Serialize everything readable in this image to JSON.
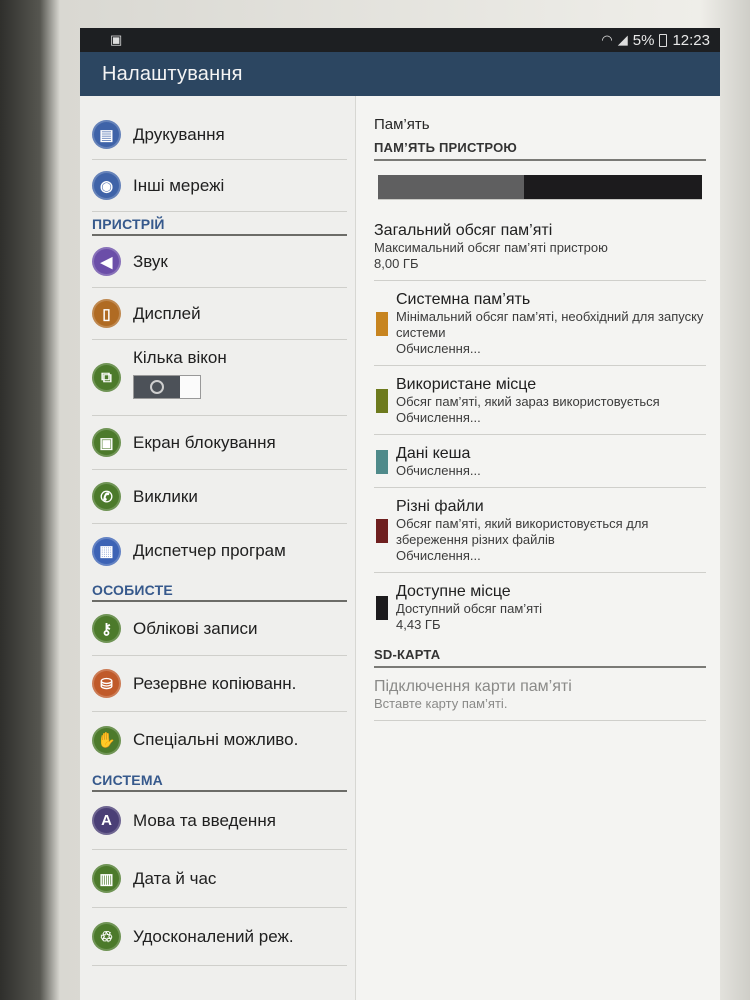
{
  "status": {
    "battery": "5%",
    "time": "12:23"
  },
  "app": {
    "title": "Налаштування"
  },
  "sidebar": {
    "items_top": [
      {
        "label": "Друкування",
        "icon": "printer-icon",
        "color": "#3f63a8"
      },
      {
        "label": "Інші мережі",
        "icon": "wireless-icon",
        "color": "#3f63a8"
      }
    ],
    "device_header": "ПРИСТРІЙ",
    "device_items": [
      {
        "label": "Звук",
        "icon": "speaker-icon",
        "color": "#6b4ea8"
      },
      {
        "label": "Дисплей",
        "icon": "display-icon",
        "color": "#b06b23"
      },
      {
        "label": "Кілька вікон",
        "icon": "multi-window-icon",
        "color": "#4c7a2b"
      },
      {
        "label": "Екран блокування",
        "icon": "lock-screen-icon",
        "color": "#4c7a2b"
      },
      {
        "label": "Виклики",
        "icon": "phone-icon",
        "color": "#4c7a2b"
      },
      {
        "label": "Диспетчер програм",
        "icon": "apps-grid-icon",
        "color": "#3d63b5"
      }
    ],
    "personal_header": "ОСОБИСТЕ",
    "personal_items": [
      {
        "label": "Облікові записи",
        "icon": "key-icon",
        "color": "#4c7a2b"
      },
      {
        "label": "Резервне копіюванн.",
        "icon": "backup-icon",
        "color": "#c05a2a"
      },
      {
        "label": "Спеціальні можливо.",
        "icon": "hand-icon",
        "color": "#4c7a2b"
      }
    ],
    "system_header": "СИСТЕМА",
    "system_items": [
      {
        "label": "Мова та введення",
        "icon": "language-icon",
        "color": "#4a3f76"
      },
      {
        "label": "Дата й час",
        "icon": "calendar-icon",
        "color": "#4c7a2b"
      },
      {
        "label": "Удосконалений реж.",
        "icon": "advanced-mode-icon",
        "color": "#4c7a2b"
      }
    ]
  },
  "storage": {
    "title": "Пам’ять",
    "device_header": "ПАМ’ЯТЬ ПРИСТРОЮ",
    "usage_bar": {
      "used_fraction": 0.45,
      "used_color": "#5f5f60",
      "free_color": "#1c1b1d"
    },
    "total": {
      "name": "Загальний обсяг пам’яті",
      "desc": "Максимальний обсяг пам’яті пристрою",
      "value": "8,00 ГБ"
    },
    "categories": [
      {
        "name": "Системна пам’ять",
        "desc": "Мінімальний обсяг пам’яті, необхідний для запуску системи",
        "value": "Обчислення...",
        "color": "#c7841f"
      },
      {
        "name": "Використане місце",
        "desc": "Обсяг пам’яті, який зараз використовується",
        "value": "Обчислення...",
        "color": "#6d7a1d"
      },
      {
        "name": "Дані кеша",
        "desc": "",
        "value": "Обчислення...",
        "color": "#4f8a8a"
      },
      {
        "name": "Різні файли",
        "desc": "Обсяг пам’яті, який використовується для збереження різних файлів",
        "value": "Обчислення...",
        "color": "#6e1f1f"
      },
      {
        "name": "Доступне місце",
        "desc": "Доступний обсяг пам’яті",
        "value": "4,43 ГБ",
        "color": "#1c1b1d"
      }
    ],
    "sd_header": "SD-КАРТА",
    "sd": {
      "name": "Підключення карти пам’яті",
      "desc": "Вставте карту пам’яті."
    }
  }
}
